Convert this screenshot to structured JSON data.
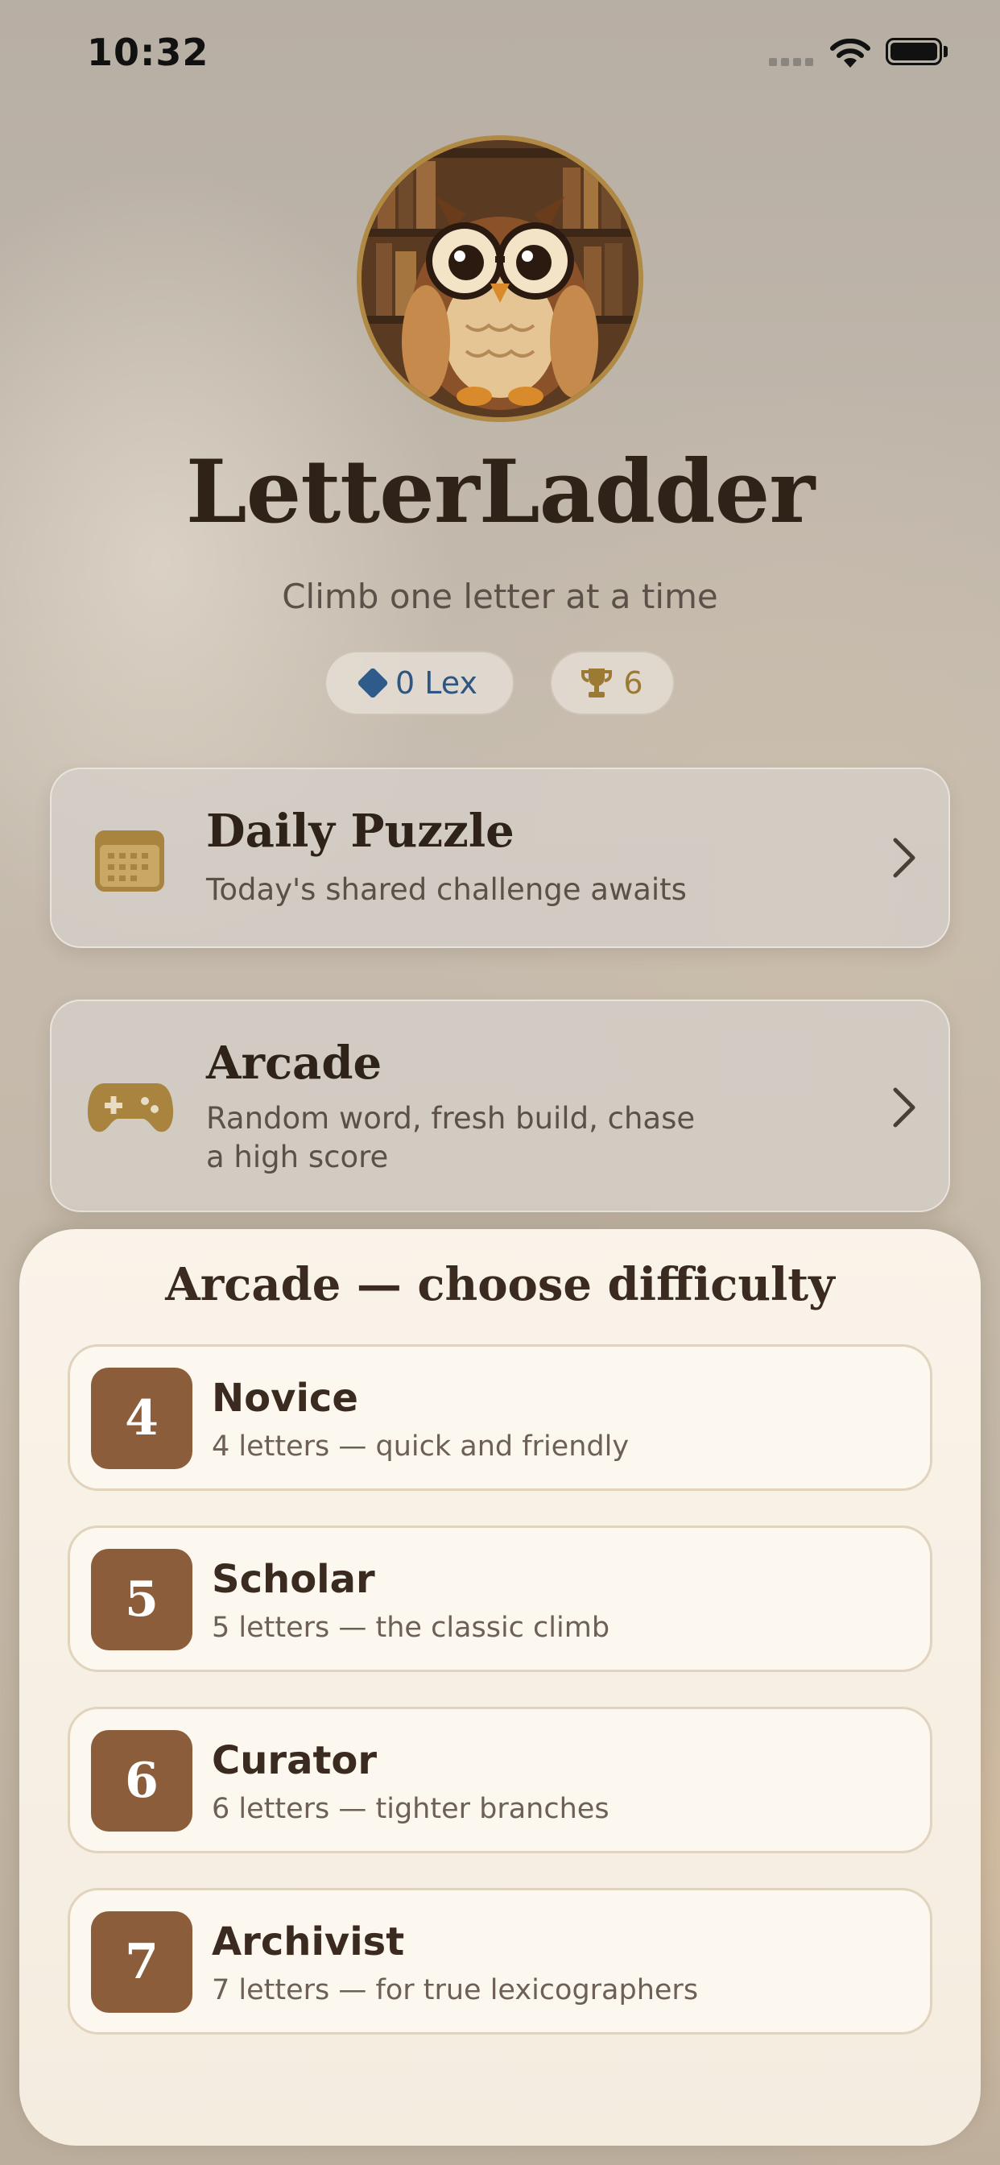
{
  "status_bar": {
    "time": "10:32"
  },
  "app": {
    "title": "LetterLadder",
    "subtitle": "Climb one letter at a time"
  },
  "stats": {
    "lex": "0 Lex",
    "trophies": "6"
  },
  "modes": [
    {
      "title": "Daily Puzzle",
      "description": "Today's shared challenge awaits",
      "icon": "calendar-icon"
    },
    {
      "title": "Arcade",
      "description": "Random word, fresh build, chase a high score",
      "icon": "gamepad-icon"
    }
  ],
  "difficulty_sheet": {
    "title": "Arcade — choose difficulty",
    "options": [
      {
        "number": "4",
        "name": "Novice",
        "description": "4 letters — quick and friendly"
      },
      {
        "number": "5",
        "name": "Scholar",
        "description": "5 letters — the classic climb"
      },
      {
        "number": "6",
        "name": "Curator",
        "description": "6 letters — tighter branches"
      },
      {
        "number": "7",
        "name": "Archivist",
        "description": "7 letters — for true lexicographers"
      }
    ]
  },
  "colors": {
    "accent_brown": "#8b5d3b",
    "lex_blue": "#2e5680",
    "trophy_gold": "#9c7a34",
    "sheet_bg": "#f9f3e9"
  }
}
